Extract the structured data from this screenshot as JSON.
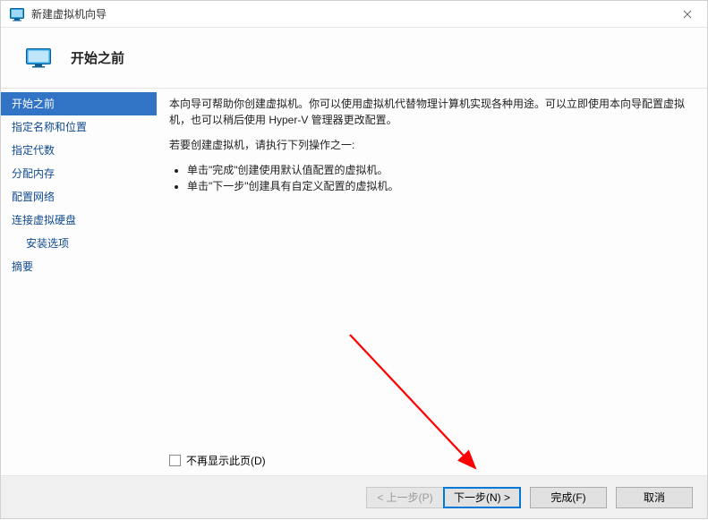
{
  "titlebar": {
    "title": "新建虚拟机向导"
  },
  "header": {
    "title": "开始之前"
  },
  "sidebar": {
    "steps": [
      {
        "label": "开始之前",
        "selected": true,
        "indent": false
      },
      {
        "label": "指定名称和位置",
        "selected": false,
        "indent": false
      },
      {
        "label": "指定代数",
        "selected": false,
        "indent": false
      },
      {
        "label": "分配内存",
        "selected": false,
        "indent": false
      },
      {
        "label": "配置网络",
        "selected": false,
        "indent": false
      },
      {
        "label": "连接虚拟硬盘",
        "selected": false,
        "indent": false
      },
      {
        "label": "安装选项",
        "selected": false,
        "indent": true
      },
      {
        "label": "摘要",
        "selected": false,
        "indent": false
      }
    ]
  },
  "content": {
    "para1": "本向导可帮助你创建虚拟机。你可以使用虚拟机代替物理计算机实现各种用途。可以立即使用本向导配置虚拟机，也可以稍后使用 Hyper-V 管理器更改配置。",
    "para2": "若要创建虚拟机，请执行下列操作之一:",
    "bullets": [
      "单击\"完成\"创建使用默认值配置的虚拟机。",
      "单击\"下一步\"创建具有自定义配置的虚拟机。"
    ],
    "dont_show_label": "不再显示此页(D)"
  },
  "footer": {
    "prev": "< 上一步(P)",
    "next": "下一步(N) >",
    "finish": "完成(F)",
    "cancel": "取消"
  }
}
